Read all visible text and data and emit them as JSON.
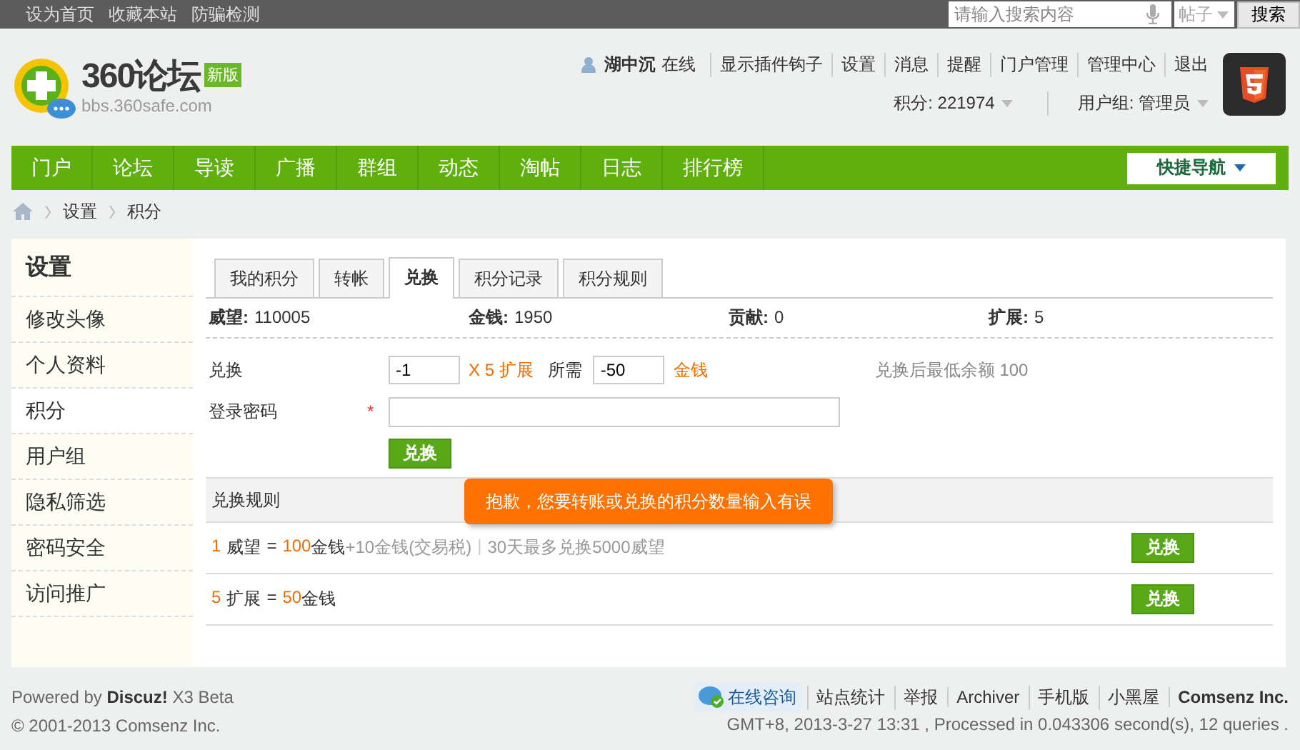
{
  "topbar": {
    "links": [
      "设为首页",
      "收藏本站",
      "防骗检测"
    ],
    "search": {
      "placeholder": "请输入搜索内容",
      "scope": "帖子",
      "button": "搜索"
    }
  },
  "header": {
    "logo": {
      "name": "360论坛",
      "badge": "新版",
      "domain": "bbs.360safe.com"
    },
    "user": {
      "name": "湖中沉",
      "status": "在线",
      "links": [
        "显示插件钩子",
        "设置",
        "消息",
        "提醒",
        "门户管理",
        "管理中心",
        "退出"
      ],
      "credits": "积分: 221974",
      "group": "用户组: 管理员"
    }
  },
  "nav": {
    "items": [
      {
        "label": "门户"
      },
      {
        "label": "论坛"
      },
      {
        "label": "导读"
      },
      {
        "label": "广播"
      },
      {
        "label": "群组"
      },
      {
        "label": "动态"
      },
      {
        "label": "淘帖"
      },
      {
        "label": "日志"
      },
      {
        "label": "排行榜"
      }
    ],
    "quick": "快捷导航"
  },
  "breadcrumb": [
    "设置",
    "积分"
  ],
  "sidebar": {
    "title": "设置",
    "items": [
      {
        "label": "修改头像",
        "selected": false
      },
      {
        "label": "个人资料",
        "selected": false
      },
      {
        "label": "积分",
        "selected": true
      },
      {
        "label": "用户组",
        "selected": false
      },
      {
        "label": "隐私筛选",
        "selected": false
      },
      {
        "label": "密码安全",
        "selected": false
      },
      {
        "label": "访问推广",
        "selected": false
      }
    ]
  },
  "tabs": [
    {
      "label": "我的积分",
      "selected": false
    },
    {
      "label": "转帐",
      "selected": false
    },
    {
      "label": "兑换",
      "selected": true
    },
    {
      "label": "积分记录",
      "selected": false
    },
    {
      "label": "积分规则",
      "selected": false
    }
  ],
  "stats": [
    {
      "label": "威望:",
      "value": "110005"
    },
    {
      "label": "金钱:",
      "value": "1950"
    },
    {
      "label": "贡献:",
      "value": "0"
    },
    {
      "label": "扩展:",
      "value": "5"
    }
  ],
  "form": {
    "exchange_label": "兑换",
    "amount": "-1",
    "rate": "X 5 扩展",
    "need_label": "所需",
    "cost": "-50",
    "cost_unit": "金钱",
    "hint": "兑换后最低余额 100",
    "password_label": "登录密码",
    "required_mark": "*",
    "submit": "兑换"
  },
  "error_popup": "抱歉，您要转账或兑换的积分数量输入有误",
  "rules": {
    "title": "兑换规则",
    "rows": [
      {
        "from_amount": "1",
        "from_unit": "威望",
        "equals": "=",
        "to_amount": "100",
        "to_unit": "金钱",
        "tax": "+10金钱(交易税)",
        "separator": "|",
        "note": "30天最多兑换5000威望",
        "button": "兑换"
      },
      {
        "from_amount": "5",
        "from_unit": "扩展",
        "equals": "=",
        "to_amount": "50",
        "to_unit": "金钱",
        "button": "兑换"
      }
    ]
  },
  "footer": {
    "powered": "Powered by **Discuz!** X3 Beta",
    "copyright": "© 2001-2013 Comsenz Inc.",
    "consult": "在线咨询",
    "links": [
      "站点统计",
      "举报",
      "Archiver",
      "手机版",
      "小黑屋"
    ],
    "company": "Comsenz Inc.",
    "stats": "GMT+8, 2013-3-27 13:31 , Processed in 0.043306 second(s), 12 queries ."
  }
}
